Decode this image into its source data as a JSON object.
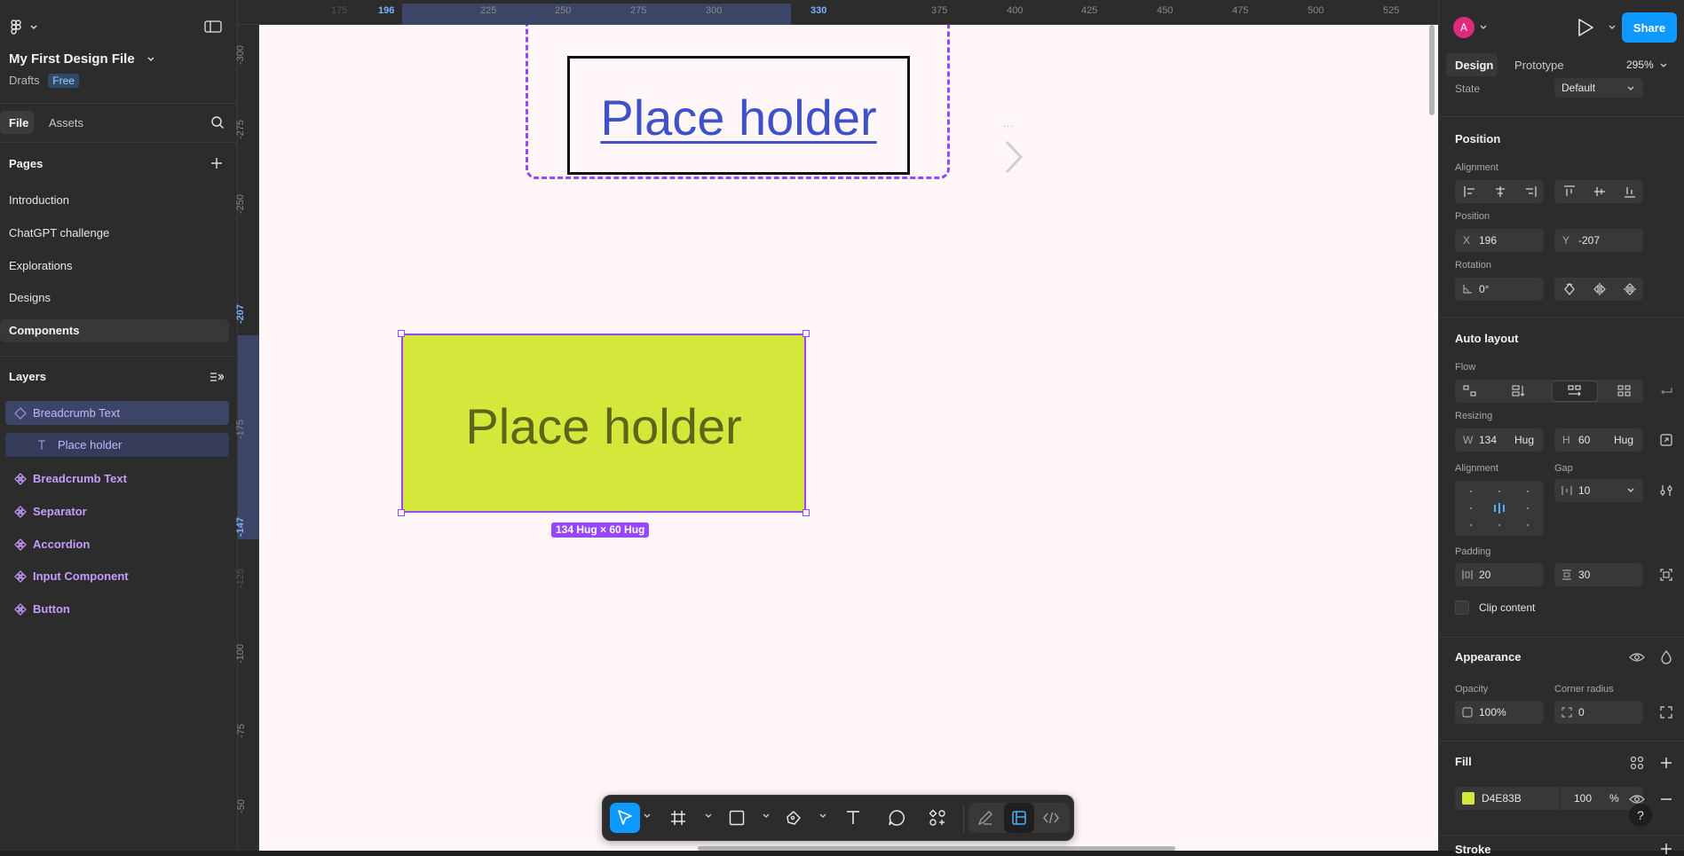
{
  "file": {
    "title": "My First Design File",
    "location": "Drafts",
    "plan_badge": "Free"
  },
  "left_tabs": {
    "file": "File",
    "assets": "Assets"
  },
  "pages": {
    "heading": "Pages",
    "items": [
      "Introduction",
      "ChatGPT challenge",
      "Explorations",
      "Designs",
      "Components"
    ],
    "selected": "Components"
  },
  "layers": {
    "heading": "Layers",
    "items": [
      {
        "name": "Breadcrumb Text",
        "kind": "component-instance",
        "selected": true
      },
      {
        "name": "Place holder",
        "kind": "text",
        "selected": true
      },
      {
        "name": "Breadcrumb Text",
        "kind": "component"
      },
      {
        "name": "Separator",
        "kind": "component"
      },
      {
        "name": "Accordion",
        "kind": "component"
      },
      {
        "name": "Input Component",
        "kind": "component"
      },
      {
        "name": "Button",
        "kind": "component"
      }
    ]
  },
  "ruler_top": [
    "175",
    "196",
    "225",
    "250",
    "275",
    "300",
    "330",
    "375",
    "400",
    "425",
    "450",
    "475",
    "500",
    "525"
  ],
  "ruler_left": [
    "-300",
    "-275",
    "-250",
    "-207",
    "-175",
    "-147",
    "-125",
    "-100",
    "-75",
    "-50"
  ],
  "canvas": {
    "top_component_text": "Place holder",
    "selected_frame_text": "Place holder",
    "selected_frame_fill": "#D4E83B",
    "size_label": "134 Hug × 60 Hug",
    "variant_dots": "..."
  },
  "header_right": {
    "avatar": "A",
    "share_label": "Share"
  },
  "panel_tabs": {
    "design": "Design",
    "prototype": "Prototype",
    "zoom": "295%"
  },
  "state": {
    "label": "State",
    "value": "Default"
  },
  "position": {
    "heading": "Position",
    "alignment_label": "Alignment",
    "position_label": "Position",
    "x_label": "X",
    "x": "196",
    "y_label": "Y",
    "y": "-207",
    "rotation_label": "Rotation",
    "rotation": "0°"
  },
  "auto_layout": {
    "heading": "Auto layout",
    "flow_label": "Flow",
    "resizing_label": "Resizing",
    "w_label": "W",
    "w": "134",
    "w_mode": "Hug",
    "h_label": "H",
    "h": "60",
    "h_mode": "Hug",
    "alignment_label": "Alignment",
    "gap_label": "Gap",
    "gap": "10",
    "padding_label": "Padding",
    "padding_h": "20",
    "padding_v": "30",
    "clip_label": "Clip content"
  },
  "appearance": {
    "heading": "Appearance",
    "opacity_label": "Opacity",
    "opacity": "100%",
    "corner_label": "Corner radius",
    "corner": "0"
  },
  "fill": {
    "heading": "Fill",
    "hex": "D4E83B",
    "color": "#D4E83B",
    "opacity": "100",
    "unit": "%"
  },
  "stroke": {
    "heading": "Stroke"
  },
  "help": "?",
  "colors": {
    "accent": "#0d99ff",
    "component_purple": "#c79cff",
    "selection": "#9747ff",
    "link_blue": "#3f51c8"
  }
}
